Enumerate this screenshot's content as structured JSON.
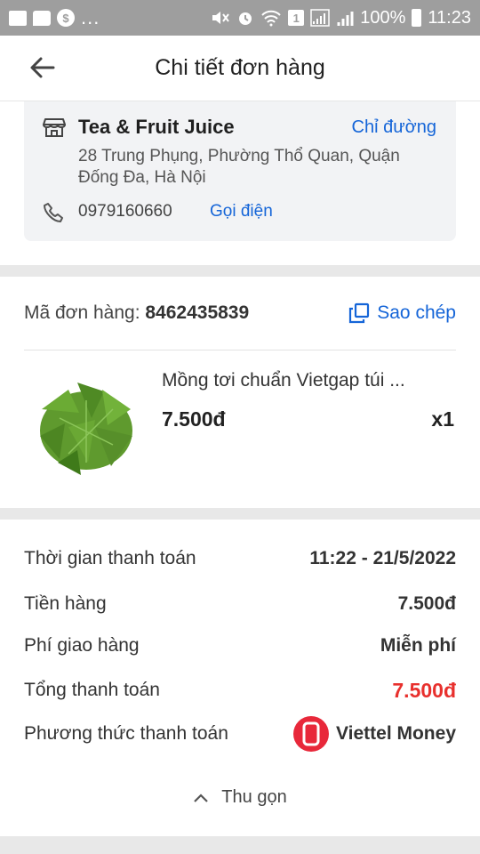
{
  "status_bar": {
    "left_dots": "...",
    "sim_badge": "1",
    "battery_percent": "100%",
    "time": "11:23"
  },
  "header": {
    "title": "Chi tiết đơn hàng"
  },
  "store": {
    "name": "Tea & Fruit Juice",
    "directions_label": "Chỉ đường",
    "address": "28 Trung Phụng, Phường Thổ Quan, Quận Đống Đa, Hà Nội",
    "phone": "0979160660",
    "call_label": "Gọi điện"
  },
  "order": {
    "id_label": "Mã đơn hàng:",
    "id_value": "8462435839",
    "copy_label": "Sao chép"
  },
  "product": {
    "name": "Mồng tơi chuẩn Vietgap túi ...",
    "price": "7.500đ",
    "quantity": "x1"
  },
  "payment": {
    "time_label": "Thời gian thanh toán",
    "time_value": "11:22 - 21/5/2022",
    "subtotal_label": "Tiền hàng",
    "subtotal_value": "7.500đ",
    "shipping_label": "Phí giao hàng",
    "shipping_value": "Miễn phí",
    "total_label": "Tổng thanh toán",
    "total_value": "7.500đ",
    "method_label": "Phương thức thanh toán",
    "method_value": "Viettel Money"
  },
  "collapse_label": "Thu gọn",
  "colors": {
    "link_blue": "#1565d8",
    "total_red": "#e8302d",
    "viettel_red": "#e8283a",
    "status_bar_gray": "#9e9e9e"
  }
}
